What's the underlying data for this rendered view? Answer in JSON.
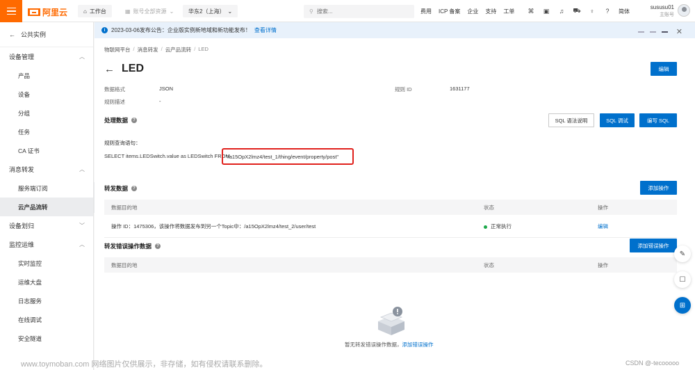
{
  "topbar": {
    "brand": "阿里云",
    "home_label": "工作台",
    "resource_label": "账号全部资源",
    "region_label": "华东2（上海）",
    "search_placeholder": "搜索...",
    "links": [
      "费用",
      "ICP 备案",
      "企业",
      "支持",
      "工单"
    ],
    "icons": [
      "terminal-icon",
      "image-icon",
      "bell-icon",
      "cart-icon",
      "bulb-icon",
      "help-icon"
    ],
    "lang": "简体",
    "user_name": "sususu01",
    "user_role": "主账号"
  },
  "sidebar": {
    "back_label": "公共实例",
    "groups": [
      {
        "label": "设备管理",
        "items": [
          "产品",
          "设备",
          "分组",
          "任务",
          "CA 证书"
        ]
      },
      {
        "label": "消息转发",
        "items": [
          "服务端订阅",
          "云产品流转"
        ]
      },
      {
        "label": "设备划归"
      },
      {
        "label": "监控运维",
        "items": [
          "实时监控",
          "运维大盘",
          "日志服务",
          "在线调试",
          "安全隧道"
        ]
      }
    ],
    "active_item": "云产品流转"
  },
  "notice": {
    "text": "2023-03-06发布公告：企业版实例新地域和新功能发布！",
    "link": "查看详情"
  },
  "breadcrumb": [
    "物联网平台",
    "消息转发",
    "云产品流转",
    "LED"
  ],
  "page": {
    "title": "LED",
    "edit_button": "编辑",
    "data_format_label": "数据格式",
    "data_format_value": "JSON",
    "rule_id_label": "规则 ID",
    "rule_id_value": "1631177",
    "rule_desc_label": "规则描述",
    "rule_desc_value": "-"
  },
  "process": {
    "title": "处理数据",
    "btn_sql_help": "SQL 语法说明",
    "btn_sql_debug": "SQL 调试",
    "btn_sql_edit": "编写 SQL",
    "query_label": "规则查询语句：",
    "sql_prefix": "SELECT items.LEDSwitch.value as LEDSwitch FROM",
    "sql_topic": "\"/a15OpX2lmz4/test_1/thing/event/property/post\""
  },
  "forward": {
    "title": "转发数据",
    "add_button": "添加操作",
    "columns": [
      "数据目的地",
      "状态",
      "操作"
    ],
    "rows": [
      {
        "dest": "操作 ID：1475306，该操作将数据发布到另一个Topic中：/a15OpX2lmz4/test_2/user/test",
        "status": "正常执行",
        "action": "编辑"
      }
    ]
  },
  "error_forward": {
    "title": "转发错误操作数据",
    "add_button": "添加错误操作",
    "columns": [
      "数据目的地",
      "状态",
      "操作"
    ],
    "empty_text": "暂无转发错误操作数据，",
    "empty_link": "添加错误操作"
  },
  "float_buttons": [
    "edit-icon",
    "chat-icon",
    "apps-icon"
  ],
  "footer": {
    "watermark": "www.toymoban.com 网络图片仅供展示，非存储，如有侵权请联系删除。",
    "credit": "CSDN @-tecooooo"
  }
}
